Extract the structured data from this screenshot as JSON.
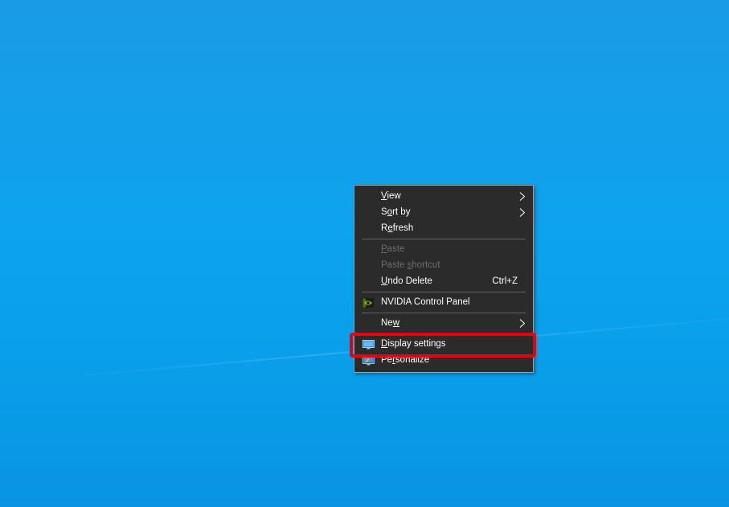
{
  "desktop": {
    "background_color": "#0ea3ee"
  },
  "context_menu": {
    "items": {
      "view": {
        "label_u": "V",
        "label_rest": "iew"
      },
      "sort_by": {
        "label_pre": "S",
        "label_u": "o",
        "label_rest": "rt by"
      },
      "refresh": {
        "label_pre": "R",
        "label_u": "e",
        "label_rest": "fresh"
      },
      "paste": {
        "label_u": "P",
        "label_rest": "aste"
      },
      "paste_shortcut": {
        "label_pre": "Paste ",
        "label_u": "s",
        "label_rest": "hortcut"
      },
      "undo_delete": {
        "label_u": "U",
        "label_rest": "ndo Delete",
        "shortcut": "Ctrl+Z"
      },
      "nvidia": {
        "label": "NVIDIA Control Panel",
        "icon": "nvidia-icon"
      },
      "new": {
        "label_pre": "Ne",
        "label_u": "w",
        "label_rest": ""
      },
      "display_settings": {
        "label_u": "D",
        "label_rest": "isplay settings",
        "icon": "display-icon"
      },
      "personalize": {
        "label_pre": "Pe",
        "label_u": "r",
        "label_rest": "sonalize",
        "icon": "personalize-icon"
      }
    }
  },
  "colors": {
    "menu_background": "#2b2b2b",
    "highlight_border": "#e8000c"
  }
}
